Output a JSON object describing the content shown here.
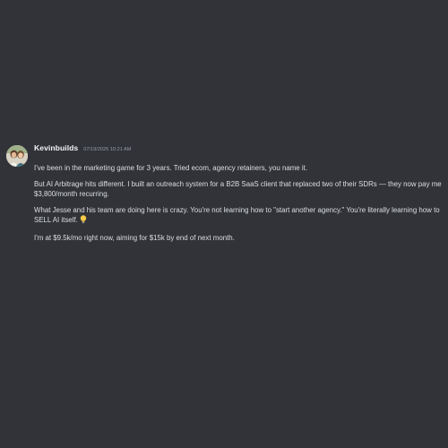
{
  "message": {
    "username": "Kevinbuilds",
    "timestamp": "07/19/2025 10:21 AM",
    "paragraphs": [
      "I've been in the marketing game for 3 years. Tried ecom, agency retainers, you name it.",
      "But AI Arbitrage hits different. I built an outreach system for a B2B SaaS client that replaced two of their SDRs — they now pay me $3,800/month recurring.",
      "What Jesse and his team are doing here is crazy. You're not learning how to \"start another agency.\" You're literally learning how to SELL AI itself.",
      "I'm at $9.5k/mo right now, aiming for $15k by end of next month."
    ],
    "emoji": "lightbulb-icon"
  },
  "colors": {
    "background": "#313338",
    "text": "#dbdee1",
    "username": "#f2f3f5",
    "timestamp": "#949ba4"
  }
}
